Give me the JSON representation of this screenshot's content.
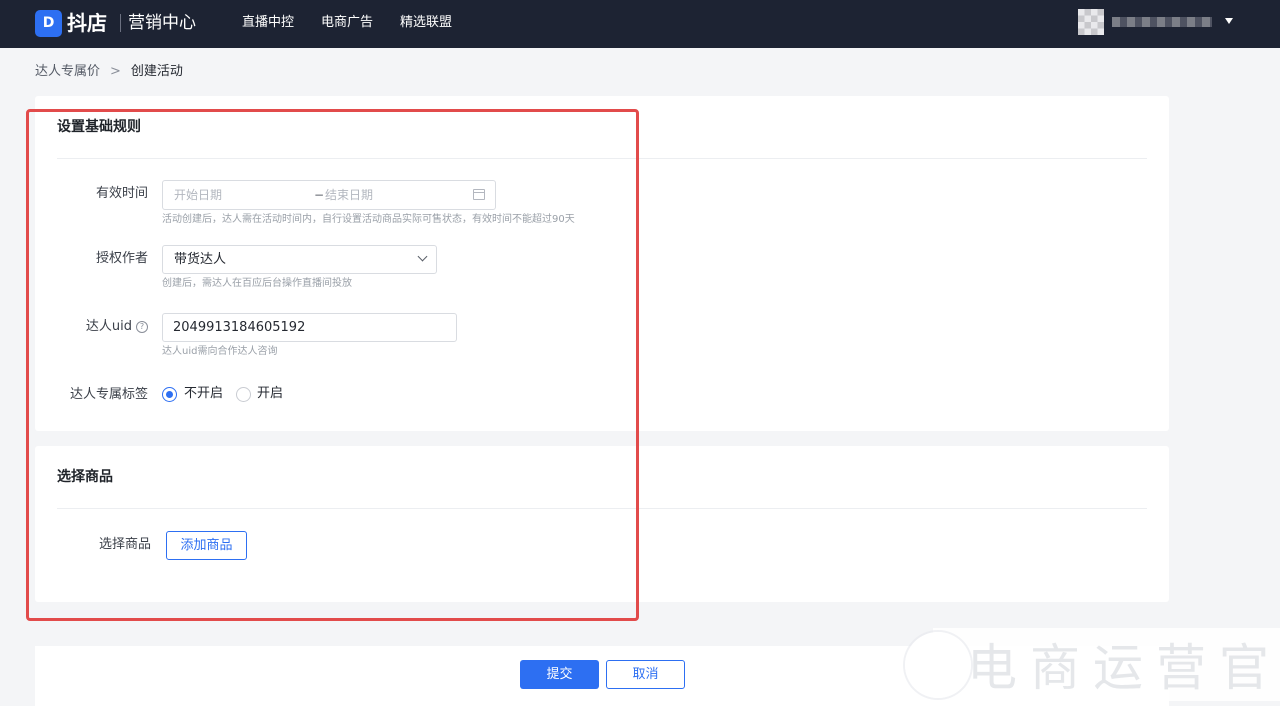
{
  "topbar": {
    "logo_mark": "D",
    "brand": "抖店",
    "product": "营销中心",
    "nav": [
      "直播中控",
      "电商广告",
      "精选联盟"
    ]
  },
  "breadcrumb": {
    "parent": "达人专属价",
    "separator": ">",
    "current": "创建活动"
  },
  "basic_rules": {
    "title": "设置基础规则",
    "validity": {
      "label": "有效时间",
      "start_placeholder": "开始日期",
      "separator": "−",
      "end_placeholder": "结束日期",
      "help": "活动创建后，达人需在活动时间内，自行设置活动商品实际可售状态，有效时间不能超过90天"
    },
    "author": {
      "label": "授权作者",
      "value": "带货达人",
      "help": "创建后，需达人在百应后台操作直播间投放"
    },
    "uid": {
      "label": "达人uid",
      "help_icon": "?",
      "value": "2049913184605192",
      "help": "达人uid需向合作达人咨询"
    },
    "exclusive_tag": {
      "label": "达人专属标签",
      "options": [
        "不开启",
        "开启"
      ],
      "selected": "不开启"
    }
  },
  "product_section": {
    "title": "选择商品",
    "label": "选择商品",
    "add_button": "添加商品"
  },
  "footer": {
    "submit": "提交",
    "cancel": "取消"
  },
  "watermark": {
    "text": "电商运营官"
  },
  "colors": {
    "topbar": "#1d2333",
    "accent": "#2d6ff2",
    "highlight": "#e24b4b"
  }
}
